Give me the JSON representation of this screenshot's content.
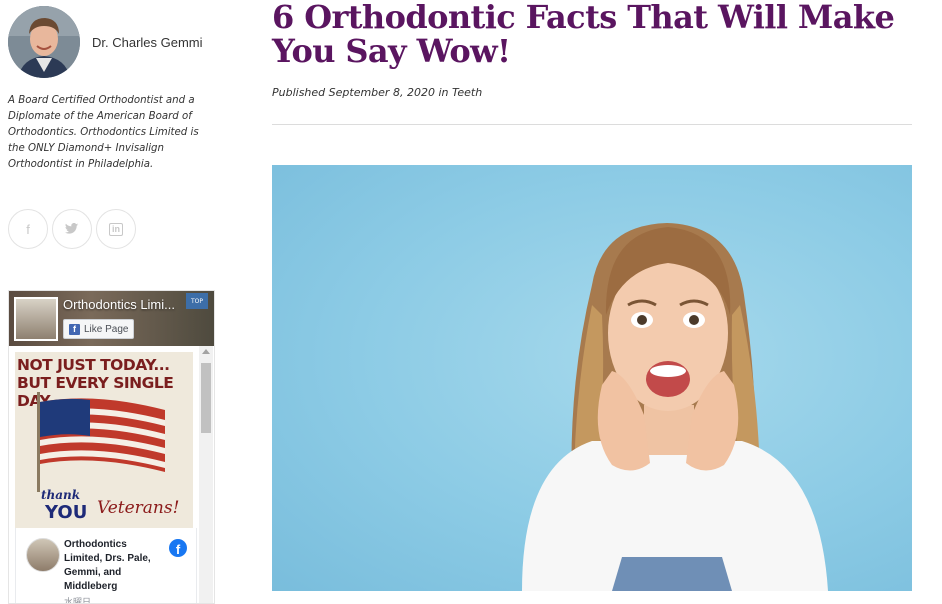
{
  "author": {
    "name": "Dr. Charles Gemmi",
    "bio": "A Board Certified Orthodontist and a Diplomate of the American Board of Orthodontics. Orthodontics Limited is the ONLY Diamond+ Invisalign Orthodontist in Philadelphia."
  },
  "social": [
    {
      "icon": "facebook-icon",
      "glyph": "f"
    },
    {
      "icon": "twitter-icon",
      "glyph": "t"
    },
    {
      "icon": "linkedin-icon",
      "glyph": "in"
    }
  ],
  "fb_widget": {
    "page_name": "Orthodontics Limi...",
    "like_label": "Like Page",
    "badge": "TOP",
    "post_image_text": {
      "line1": "NOT JUST TODAY...",
      "line2": "BUT EVERY SINGLE DAY,",
      "thank": "thank",
      "you": "YOU",
      "veterans": "Veterans!"
    },
    "post_author": "Orthodontics Limited, Drs. Pale, Gemmi, and Middleberg",
    "post_date": "水曜日"
  },
  "article": {
    "title": "6 Orthodontic Facts That Will Make You Say Wow!",
    "published_prefix": "Published",
    "published_date": "September 8, 2020",
    "in_word": "in",
    "category": "Teeth"
  },
  "colors": {
    "title": "#5a1560",
    "hero_bg": "#8ccbe5",
    "facebook_blue": "#1877f2"
  }
}
